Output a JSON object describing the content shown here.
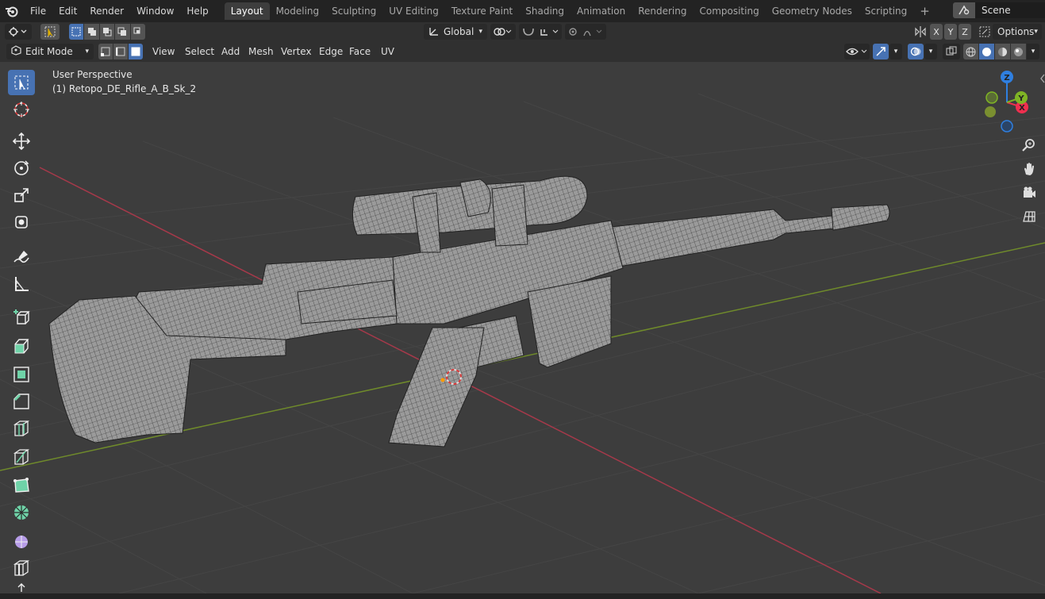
{
  "menu": {
    "items": [
      "File",
      "Edit",
      "Render",
      "Window",
      "Help"
    ]
  },
  "workspaces": {
    "tabs": [
      "Layout",
      "Modeling",
      "Sculpting",
      "UV Editing",
      "Texture Paint",
      "Shading",
      "Animation",
      "Rendering",
      "Compositing",
      "Geometry Nodes",
      "Scripting"
    ],
    "active": "Layout",
    "add_label": "+"
  },
  "scene": {
    "name": "Scene"
  },
  "header": {
    "transform_orientation": "Global",
    "axis_x": "X",
    "axis_y": "Y",
    "axis_z": "Z",
    "options_label": "Options",
    "mode": "Edit Mode",
    "menus": [
      "View",
      "Select",
      "Add",
      "Mesh",
      "Vertex",
      "Edge",
      "Face",
      "UV"
    ]
  },
  "viewport": {
    "perspective_label": "User Perspective",
    "object_label": "(1) Retopo_DE_Rifle_A_B_Sk_2"
  },
  "gizmo": {
    "x_label": "X",
    "y_label": "Y",
    "z_label": "Z",
    "x_color": "#f02f4f",
    "y_color": "#7fb425",
    "z_color": "#2f7fe0"
  },
  "tools": [
    "select-box-icon",
    "cursor-icon",
    "move-icon",
    "rotate-icon",
    "scale-icon",
    "transform-icon",
    "annotate-icon",
    "measure-icon",
    "add-cube-icon",
    "extrude-icon",
    "inset-icon",
    "bevel-icon",
    "loop-cut-icon",
    "knife-icon",
    "poly-build-icon",
    "spin-icon",
    "smooth-icon",
    "edge-slide-icon"
  ],
  "nav": [
    "zoom-icon",
    "pan-hand-icon",
    "camera-icon",
    "ortho-grid-icon"
  ],
  "colors": {
    "accent": "#4772b3",
    "viewport_bg": "#3d3d3d",
    "header_bg": "#303030",
    "topbar_bg": "#232323"
  }
}
